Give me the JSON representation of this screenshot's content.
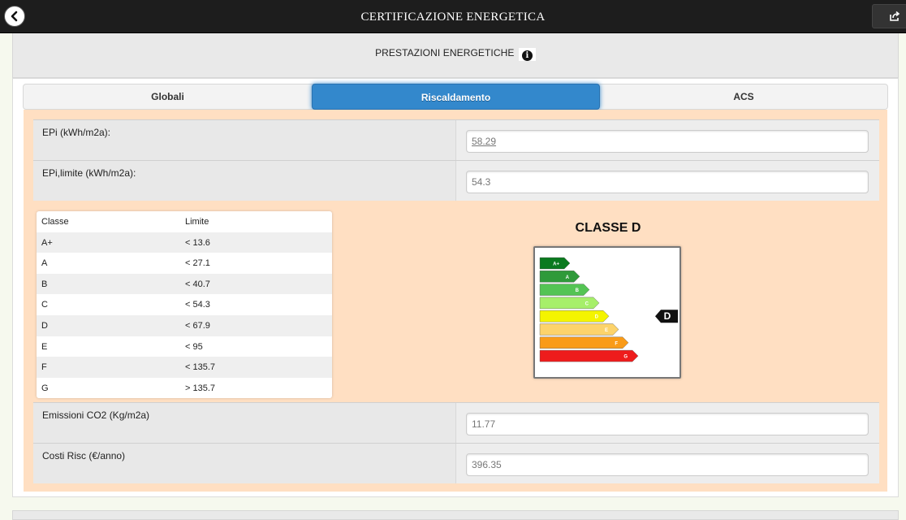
{
  "header": {
    "title": "CERTIFICAZIONE ENERGETICA"
  },
  "section": {
    "title": "PRESTAZIONI ENERGETICHE"
  },
  "tabs": [
    {
      "label": "Globali",
      "active": false
    },
    {
      "label": "Riscaldamento",
      "active": true
    },
    {
      "label": "ACS",
      "active": false
    }
  ],
  "fields": {
    "epi": {
      "label": "EPi (kWh/m2a):",
      "value": "58.29"
    },
    "epi_limite": {
      "label": "EPi,limite (kWh/m2a):",
      "value": "54.3"
    },
    "emissioni": {
      "label": "Emissioni CO2 (Kg/m2a)",
      "value": "11.77"
    },
    "costi": {
      "label": "Costi Risc (€/anno)",
      "value": "396.35"
    }
  },
  "class_table": {
    "headers": [
      "Classe",
      "Limite"
    ],
    "rows": [
      {
        "classe": "A+",
        "limite": "< 13.6"
      },
      {
        "classe": "A",
        "limite": "< 27.1"
      },
      {
        "classe": "B",
        "limite": "< 40.7"
      },
      {
        "classe": "C",
        "limite": "< 54.3"
      },
      {
        "classe": "D",
        "limite": "< 67.9"
      },
      {
        "classe": "E",
        "limite": "< 95"
      },
      {
        "classe": "F",
        "limite": "< 135.7"
      },
      {
        "classe": "G",
        "limite": "> 135.7"
      }
    ]
  },
  "energy_label": {
    "title": "CLASSE D",
    "current_class": "D",
    "bars": [
      {
        "label": "A+",
        "color": "#0b7a1f"
      },
      {
        "label": "A",
        "color": "#2f9a3a"
      },
      {
        "label": "B",
        "color": "#54c454"
      },
      {
        "label": "C",
        "color": "#a6ef6a"
      },
      {
        "label": "D",
        "color": "#f4f400"
      },
      {
        "label": "E",
        "color": "#fcd36b"
      },
      {
        "label": "F",
        "color": "#f99b18"
      },
      {
        "label": "G",
        "color": "#ee1c1c"
      }
    ]
  },
  "colors": {
    "accent": "#3388cc",
    "content_bg": "#ffdfc2",
    "topbar": "#1d1d1d"
  },
  "icons": {
    "back": "chevron-left-icon",
    "share": "share-icon",
    "info": "info-icon"
  }
}
